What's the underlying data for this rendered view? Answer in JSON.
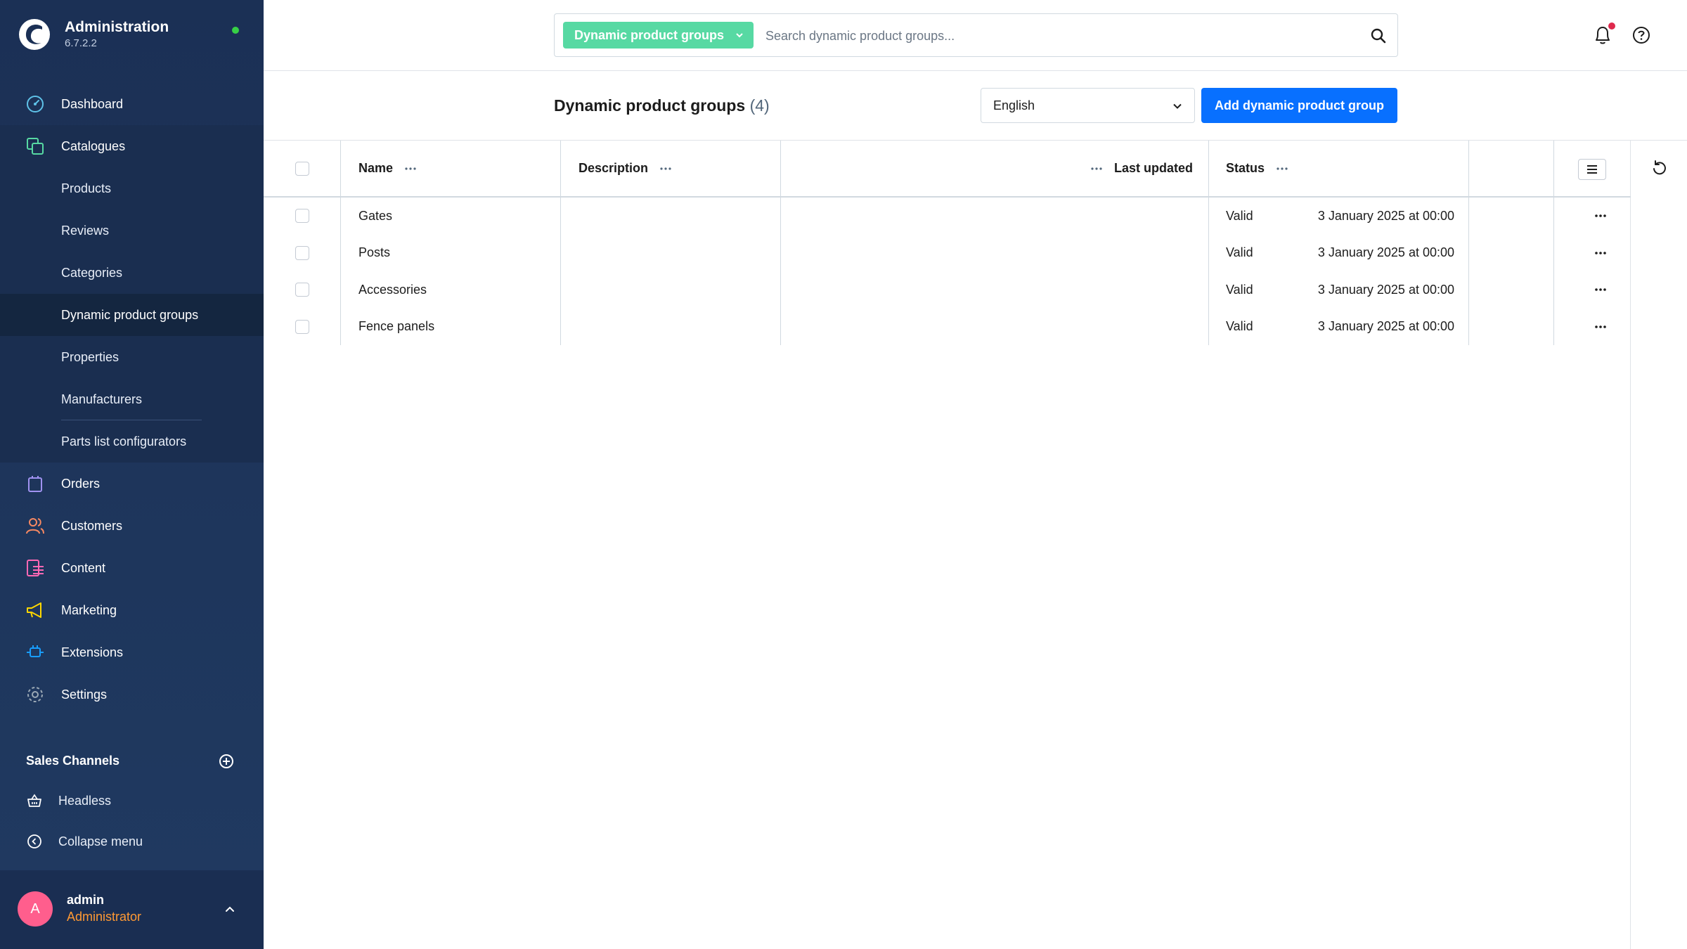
{
  "app": {
    "title": "Administration",
    "version": "6.7.2.2"
  },
  "sidebar": {
    "items": [
      {
        "label": "Dashboard",
        "icon": "dashboard-icon"
      },
      {
        "label": "Catalogues",
        "icon": "catalogues-icon"
      },
      {
        "label": "Orders",
        "icon": "orders-icon"
      },
      {
        "label": "Customers",
        "icon": "customers-icon"
      },
      {
        "label": "Content",
        "icon": "content-icon"
      },
      {
        "label": "Marketing",
        "icon": "marketing-icon"
      },
      {
        "label": "Extensions",
        "icon": "extensions-icon"
      },
      {
        "label": "Settings",
        "icon": "settings-icon"
      }
    ],
    "catalogue_sub": [
      "Products",
      "Reviews",
      "Categories",
      "Dynamic product groups",
      "Properties",
      "Manufacturers",
      "Parts list configurators"
    ],
    "sales_channels_title": "Sales Channels",
    "sales_channels": [
      "Headless"
    ],
    "collapse_label": "Collapse menu"
  },
  "user": {
    "initial": "A",
    "name": "admin",
    "role": "Administrator"
  },
  "search": {
    "type_label": "Dynamic product groups",
    "placeholder": "Search dynamic product groups..."
  },
  "page": {
    "title": "Dynamic product groups",
    "count": "(4)",
    "language": "English",
    "add_button": "Add dynamic product group"
  },
  "grid": {
    "columns": [
      "Name",
      "Description",
      "Last updated",
      "Status"
    ],
    "rows": [
      {
        "name": "Gates",
        "description": "",
        "updated": "3 January 2025 at 00:00",
        "status": "Valid"
      },
      {
        "name": "Posts",
        "description": "",
        "updated": "3 January 2025 at 00:00",
        "status": "Valid"
      },
      {
        "name": "Accessories",
        "description": "",
        "updated": "3 January 2025 at 00:00",
        "status": "Valid"
      },
      {
        "name": "Fence panels",
        "description": "",
        "updated": "3 January 2025 at 00:00",
        "status": "Valid"
      }
    ]
  },
  "colors": {
    "sidebar_bg": "#1b3055",
    "accent_green": "#57d9a3",
    "primary_blue": "#0870ff",
    "role_orange": "#ff9933",
    "avatar_pink": "#ff5e8d",
    "notification_red": "#de294c",
    "online_green": "#37d046"
  }
}
